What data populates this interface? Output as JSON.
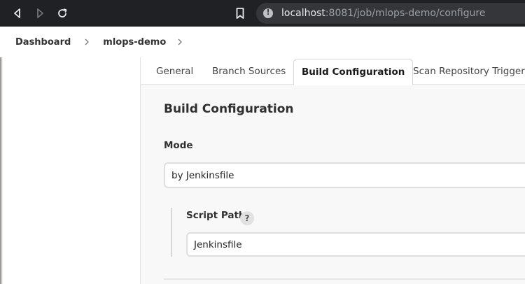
{
  "browser": {
    "back_icon": "back-arrow-icon",
    "forward_icon": "forward-arrow-icon",
    "reload_icon": "reload-icon",
    "bookmark_icon": "bookmark-icon",
    "site_info_icon": "info-icon",
    "url_host": "localhost",
    "url_rest": ":8081/job/mlops-demo/configure"
  },
  "breadcrumb": {
    "items": [
      {
        "label": "Dashboard"
      },
      {
        "label": "mlops-demo"
      }
    ]
  },
  "tabs": [
    {
      "label": "General"
    },
    {
      "label": "Branch Sources"
    },
    {
      "label": "Build Configuration",
      "active": true
    },
    {
      "label": "Scan Repository Triggers"
    }
  ],
  "section": {
    "title": "Build Configuration",
    "mode_label": "Mode",
    "mode_value": "by Jenkinsfile",
    "script_path_label": "Script Path",
    "help_glyph": "?",
    "script_path_value": "Jenkinsfile"
  }
}
